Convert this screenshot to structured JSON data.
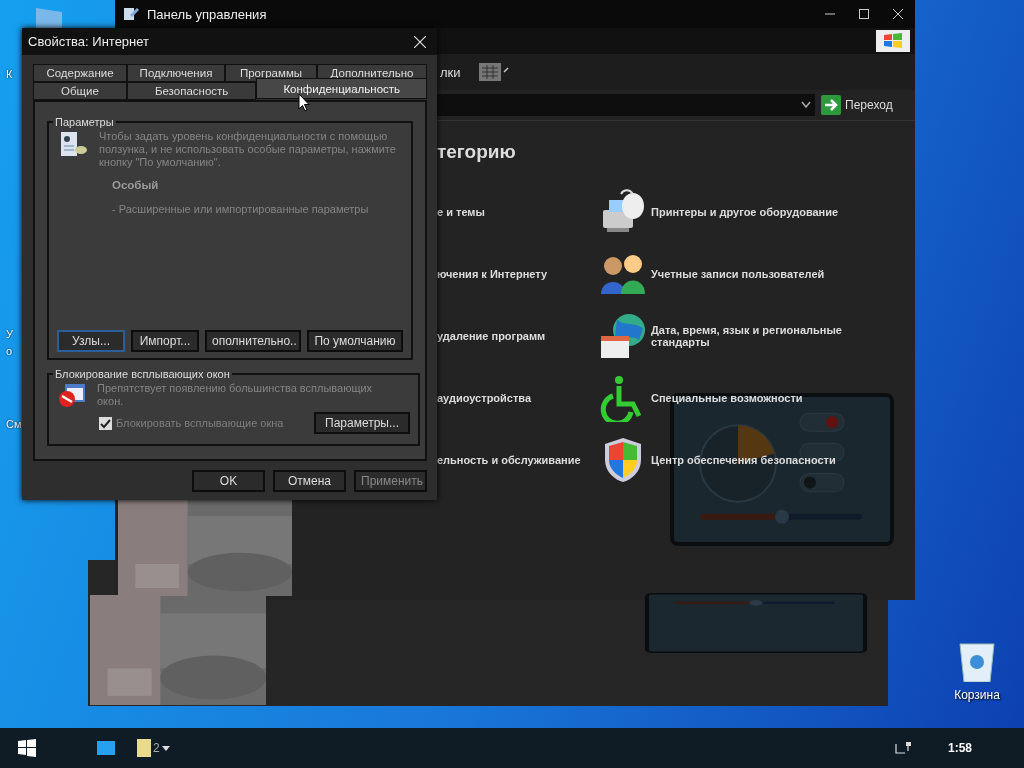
{
  "desktop": {
    "icon_labels": [
      "К",
      "У",
      "о",
      "См"
    ],
    "recycle_bin": {
      "label": "Корзина"
    }
  },
  "control_panel": {
    "title": "Панель управления",
    "toolbar": {
      "label": "лки"
    },
    "address_bar": {
      "go_button": "Переход"
    },
    "heading": "тегорию",
    "left_categories": [
      "е и темы",
      "ючения к Интернету",
      "удаление программ",
      "аудиоустройства",
      "ельность и обслуживание"
    ],
    "right_categories": [
      {
        "kind": "printer",
        "label": "Принтеры и другое оборудование"
      },
      {
        "kind": "users",
        "label": "Учетные записи пользователей"
      },
      {
        "kind": "datetime",
        "label": "Дата, время, язык и региональные стандарты"
      },
      {
        "kind": "accessibility",
        "label": "Специальные возможности"
      },
      {
        "kind": "security",
        "label": "Центр обеспечения безопасности"
      }
    ]
  },
  "dialog": {
    "title": "Свойства: Интернет",
    "tab_rows": [
      [
        {
          "label": "Содержание",
          "selected": false
        },
        {
          "label": "Подключения",
          "selected": false
        },
        {
          "label": "Программы",
          "selected": false
        },
        {
          "label": "Дополнительно",
          "selected": false
        }
      ],
      [
        {
          "label": "Общие",
          "selected": false
        },
        {
          "label": "Безопасность",
          "selected": false
        },
        {
          "label": "Конфиденциальность",
          "selected": true
        }
      ]
    ],
    "settings_group": {
      "legend": "Параметры",
      "description": "Чтобы задать уровень конфиденциальности с помощью ползунка, и не использовать особые параметры, нажмите кнопку \"По умолчанию\".",
      "level_name": "Особый",
      "level_detail": "- Расширенные или импортированные параметры",
      "buttons": [
        {
          "label": "Узлы...",
          "focused": true
        },
        {
          "label": "Импорт...",
          "focused": false
        },
        {
          "label": "ополнительно..",
          "focused": false
        },
        {
          "label": "По умолчанию",
          "focused": false
        }
      ]
    },
    "popup_group": {
      "legend": "Блокирование всплывающих окон",
      "description": "Препятствует появлению большинства всплывающих окон.",
      "checkbox": {
        "label": "Блокировать всплывающие окна",
        "checked": true
      },
      "button": "Параметры..."
    },
    "footer_buttons": [
      {
        "label": "OK",
        "disabled": false
      },
      {
        "label": "Отмена",
        "disabled": false
      },
      {
        "label": "Применить",
        "disabled": true
      }
    ]
  },
  "taskbar": {
    "window_count": "2",
    "clock": "1:58"
  }
}
